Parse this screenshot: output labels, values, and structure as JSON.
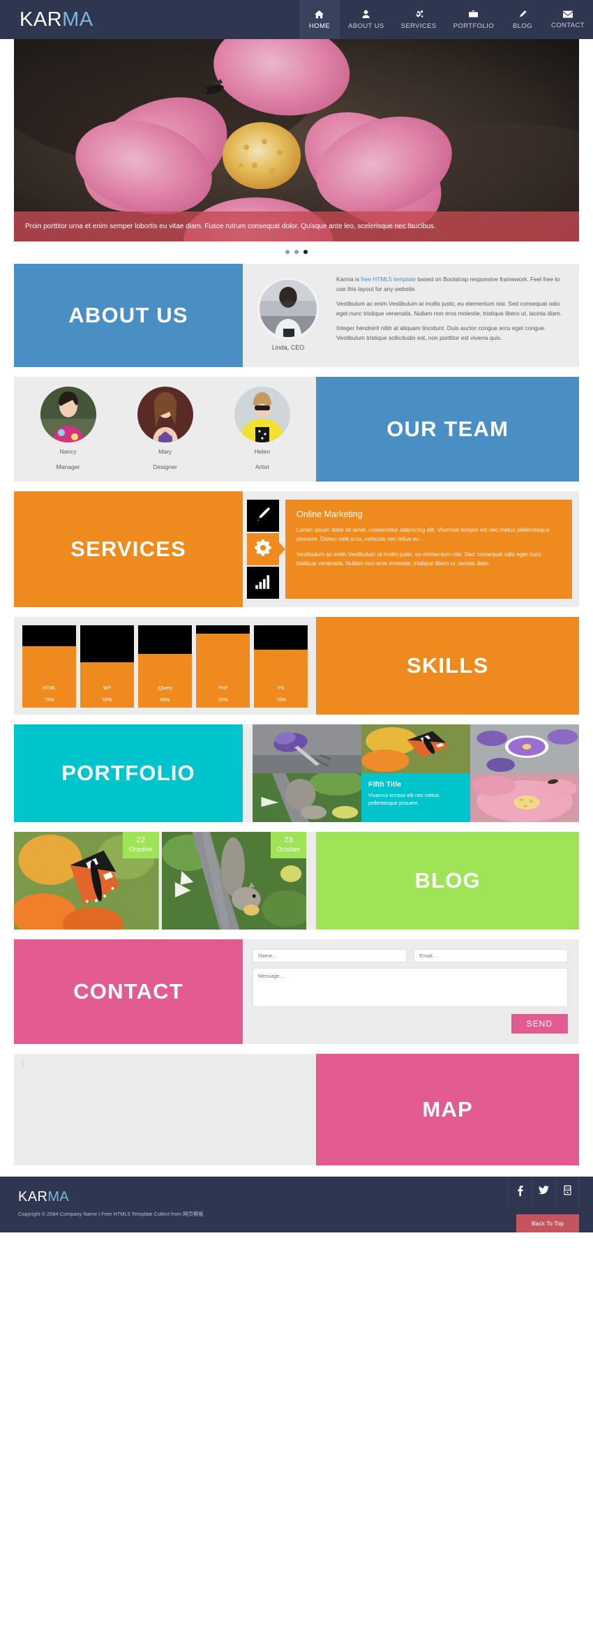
{
  "nav": {
    "brand_part1": "KAR",
    "brand_part2": "MA",
    "items": [
      {
        "label": "HOME",
        "icon": "home-icon",
        "active": true
      },
      {
        "label": "ABOUT US",
        "icon": "user-icon",
        "active": false
      },
      {
        "label": "SERVICES",
        "icon": "gears-icon",
        "active": false
      },
      {
        "label": "PORTFOLIO",
        "icon": "briefcase-icon",
        "active": false
      },
      {
        "label": "BLOG",
        "icon": "pencil-icon",
        "active": false
      },
      {
        "label": "CONTACT",
        "icon": "envelope-icon",
        "active": false
      }
    ]
  },
  "hero": {
    "caption": "Proin porttitor urna et enim semper lobortis eu vitae diam. Fusce rutrum consequat dolor. Quisque ante leo, scelerisque nec faucibus.",
    "slide_count": 3,
    "active_slide": 3
  },
  "about": {
    "heading": "ABOUT US",
    "panel_color": "#4a8fc4",
    "photo_caption": "Linda, CEO",
    "para1_before": "Karma is ",
    "para1_link": "free HTML5 template",
    "para1_after": " based on Bootstrap responsive framework. Feel free to use this layout for any website.",
    "para2": "Vestibulum ac enim.Vestibulum at mollis justo, eu elementum nisi. Sed consequat odio eget nunc tristique venenatis. Nullam non eros molestie, tristique libero ut, lacinia diam.",
    "para3": "Integer hendrerit nibh at aliquam tincidunt. Duis auctor congue arcu eget congue. Vestibulum tristique sollicitudin est, non porttitor est viverra quis."
  },
  "team": {
    "heading": "OUR TEAM",
    "panel_color": "#4a8fc4",
    "members": [
      {
        "name": "Nancy",
        "role": "Manager"
      },
      {
        "name": "Mary",
        "role": "Designer"
      },
      {
        "name": "Helen",
        "role": "Artist"
      }
    ]
  },
  "services": {
    "heading": "SERVICES",
    "panel_color": "#ef8b1e",
    "icons": [
      {
        "name": "pencil-icon",
        "active": false
      },
      {
        "name": "gear-icon",
        "active": true
      },
      {
        "name": "bar-chart-icon",
        "active": false
      }
    ],
    "card_title": "Online Marketing",
    "card_para1": "Lorem ipsum dolor sit amet, consectetur adipiscing elit. Vivamus tempor elit nec metus pellentesque posuere. Donec velit arcu, vehicula nec tellus eu.",
    "card_para2": "Vestibulum ac enim.Vestibulum at mollis justo, eu elementum nisi. Sed consequat odio eget nunc tristique venenatis. Nullam non eros molestie, tristique libero ut, lacinia diam."
  },
  "skills": {
    "heading": "SKILLS",
    "panel_color": "#ef8b1e"
  },
  "chart_data": {
    "type": "bar",
    "title": "SKILLS",
    "categories": [
      "HTML",
      "WP",
      "jQuery",
      "PHP",
      "PS"
    ],
    "values": [
      75,
      55,
      65,
      90,
      70
    ],
    "value_labels": [
      "75%",
      "55%",
      "65%",
      "90%",
      "70%"
    ],
    "ylim": [
      0,
      100
    ],
    "ylabel": "",
    "xlabel": "",
    "bar_color": "#ef8b1e",
    "track_color": "#000000",
    "grid": false,
    "legend": "none"
  },
  "portfolio": {
    "heading": "PORTFOLIO",
    "panel_color": "#00c4cc",
    "overlay_title": "Fifth Title",
    "overlay_text": "Vivamus tempor elit nec metus pellentesque posuere."
  },
  "blog": {
    "heading": "BLOG",
    "panel_color": "#9fe356",
    "posts": [
      {
        "day": "22",
        "month": "October"
      },
      {
        "day": "23",
        "month": "October"
      }
    ]
  },
  "contact": {
    "heading": "CONTACT",
    "panel_color": "#e25b91",
    "name_placeholder": "Name...",
    "email_placeholder": "Email...",
    "message_placeholder": "Message....",
    "send_label": "SEND"
  },
  "map": {
    "heading": "MAP",
    "panel_color": "#e25b91"
  },
  "footer": {
    "brand_part1": "KAR",
    "brand_part2": "MA",
    "copyright": "Copyright © 2084 Company Name | Free HTML5 Template Collect from 网页模板",
    "socials": [
      "facebook-icon",
      "twitter-icon",
      "youtube-icon"
    ],
    "back_to_top": "Back To Top"
  }
}
